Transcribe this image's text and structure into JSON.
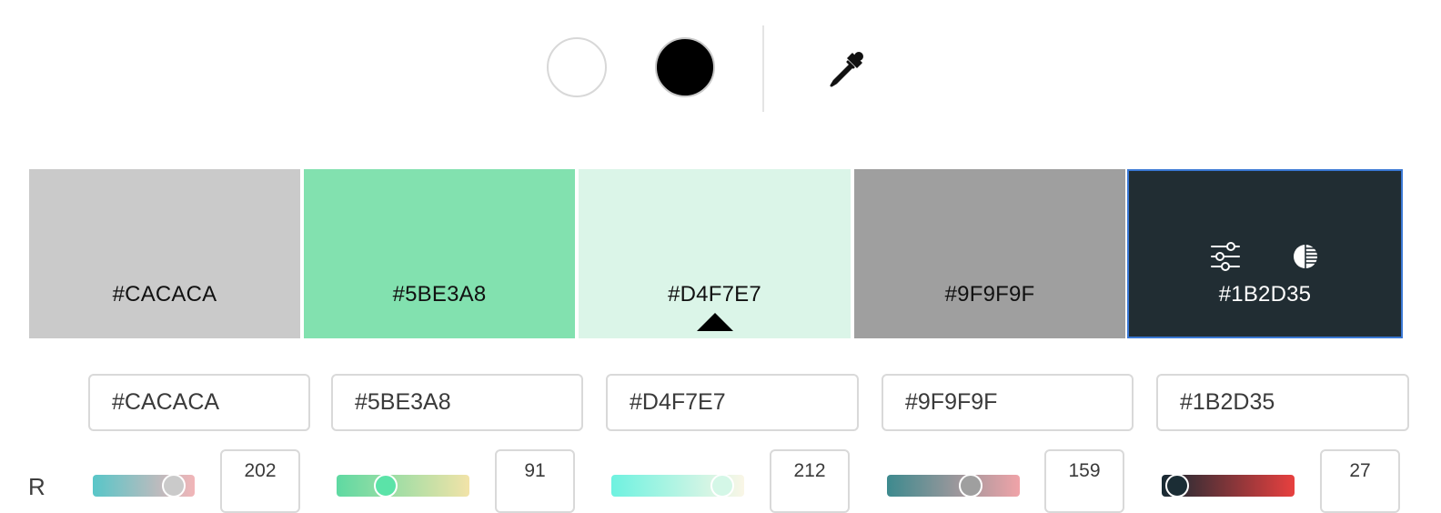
{
  "toolbar": {
    "white_swatch_icon": "circle-white",
    "black_swatch_icon": "circle-black",
    "eyedropper_icon": "eyedropper-icon"
  },
  "swatches": [
    {
      "hex": "#CACACA",
      "bg": "#CACACA",
      "text_color": "#111111"
    },
    {
      "hex": "#5BE3A8",
      "bg": "#82E1AF",
      "text_color": "#111111"
    },
    {
      "hex": "#D4F7E7",
      "bg": "#DBF5E8",
      "text_color": "#111111"
    },
    {
      "hex": "#9F9F9F",
      "bg": "#9F9F9F",
      "text_color": "#111111"
    },
    {
      "hex": "#1B2D35",
      "bg": "#212D33",
      "text_color": "#FFFFFF"
    }
  ],
  "selected_swatch_index": 4,
  "base_swatch_index": 2,
  "selected_tools": {
    "adjust_icon": "sliders-icon",
    "contrast_icon": "contrast-icon"
  },
  "hex_inputs": [
    {
      "value": "#CACACA"
    },
    {
      "value": "#5BE3A8"
    },
    {
      "value": "#D4F7E7"
    },
    {
      "value": "#9F9F9F"
    },
    {
      "value": "#1B2D35"
    }
  ],
  "rgb_rows": {
    "r": {
      "label": "R",
      "values": [
        "202",
        "91",
        "212",
        "159",
        "27"
      ],
      "levels": [
        0.79,
        0.36,
        0.83,
        0.62,
        0.11
      ],
      "thumb_colors": [
        "#CACACA",
        "#5BE3A8",
        "#D4F7E7",
        "#9F9F9F",
        "#1B2D35"
      ],
      "gradient_start": [
        "#58C6C8",
        "#5ED9A2",
        "#6EF2E0",
        "#3D8A8E",
        "#162A33"
      ],
      "gradient_end": [
        "#F2B5B8",
        "#F2E3A8",
        "#FAF6E6",
        "#F0A3A8",
        "#E8403F"
      ]
    }
  }
}
